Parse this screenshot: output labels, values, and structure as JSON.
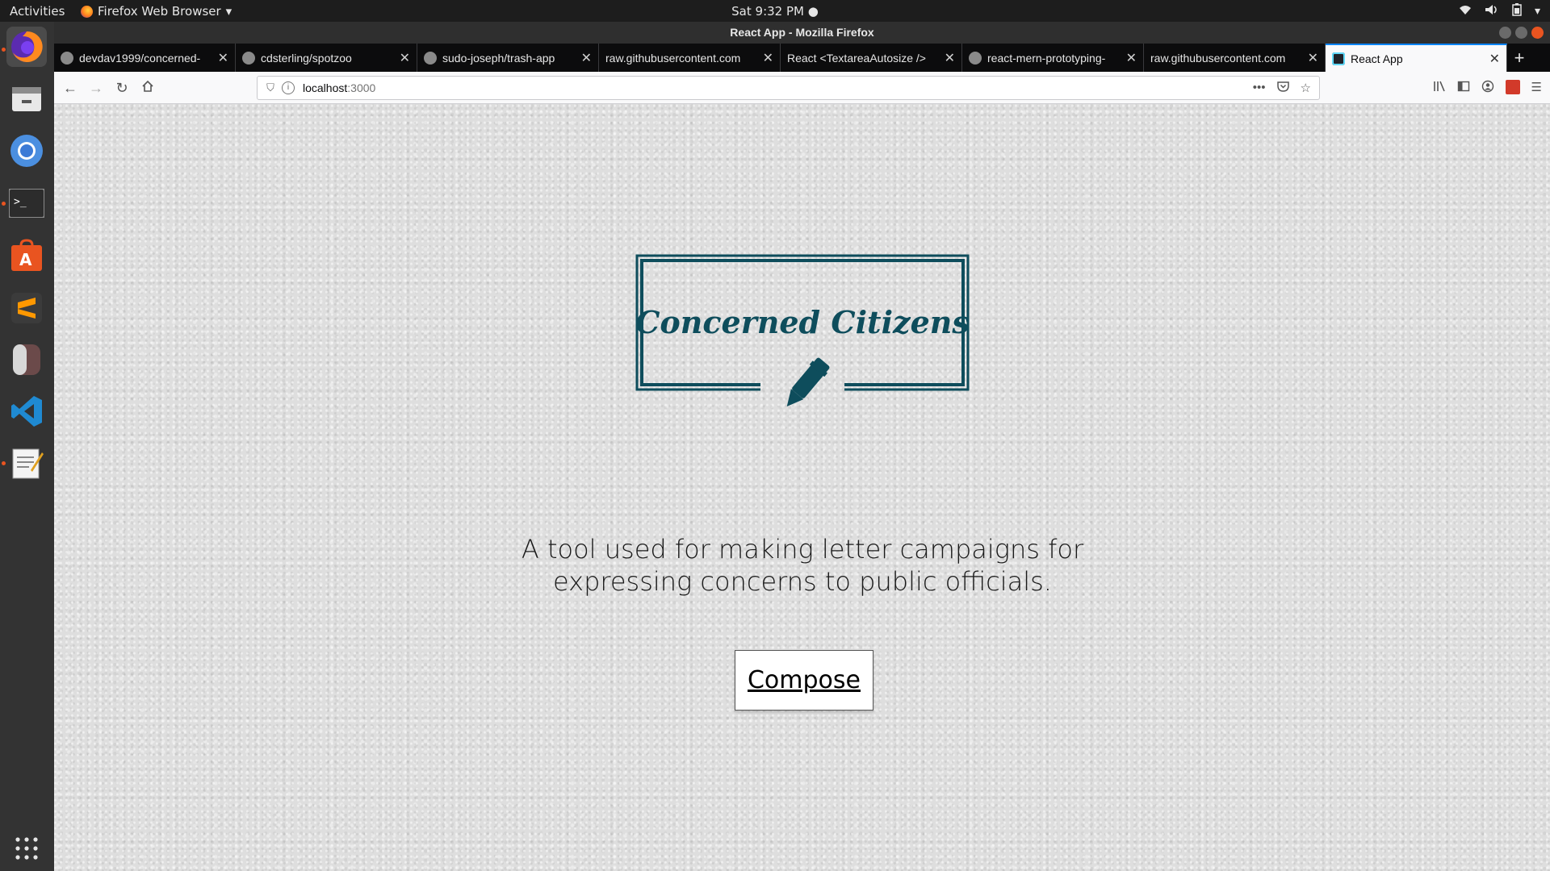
{
  "topbar": {
    "activities": "Activities",
    "app_name": "Firefox Web Browser",
    "clock": "Sat  9:32 PM"
  },
  "dock": {
    "items": [
      "firefox-icon",
      "files-icon",
      "chromium-icon",
      "terminal-icon",
      "software-center-icon",
      "sublime-text-icon",
      "app-icon",
      "vscode-icon",
      "text-editor-icon",
      "show-apps-icon"
    ]
  },
  "window": {
    "title": "React App - Mozilla Firefox"
  },
  "tabs": [
    {
      "label": "devdav1999/concerned-",
      "icon": "github-icon"
    },
    {
      "label": "cdsterling/spotzoo",
      "icon": "github-icon"
    },
    {
      "label": "sudo-joseph/trash-app",
      "icon": "github-icon"
    },
    {
      "label": "raw.githubusercontent.com",
      "icon": ""
    },
    {
      "label": "React <TextareaAutosize />",
      "icon": ""
    },
    {
      "label": "react-mern-prototyping-",
      "icon": "github-icon"
    },
    {
      "label": "raw.githubusercontent.com",
      "icon": ""
    },
    {
      "label": "React App",
      "icon": "react-icon",
      "active": true
    }
  ],
  "urlbar": {
    "host": "localhost",
    "port": ":3000"
  },
  "page": {
    "logo_text": "Concerned Citizens",
    "tagline": "A tool used for making letter campaigns for expressing concerns to public officials.",
    "compose_label": "Compose",
    "accent_color": "#0e4d5c"
  }
}
